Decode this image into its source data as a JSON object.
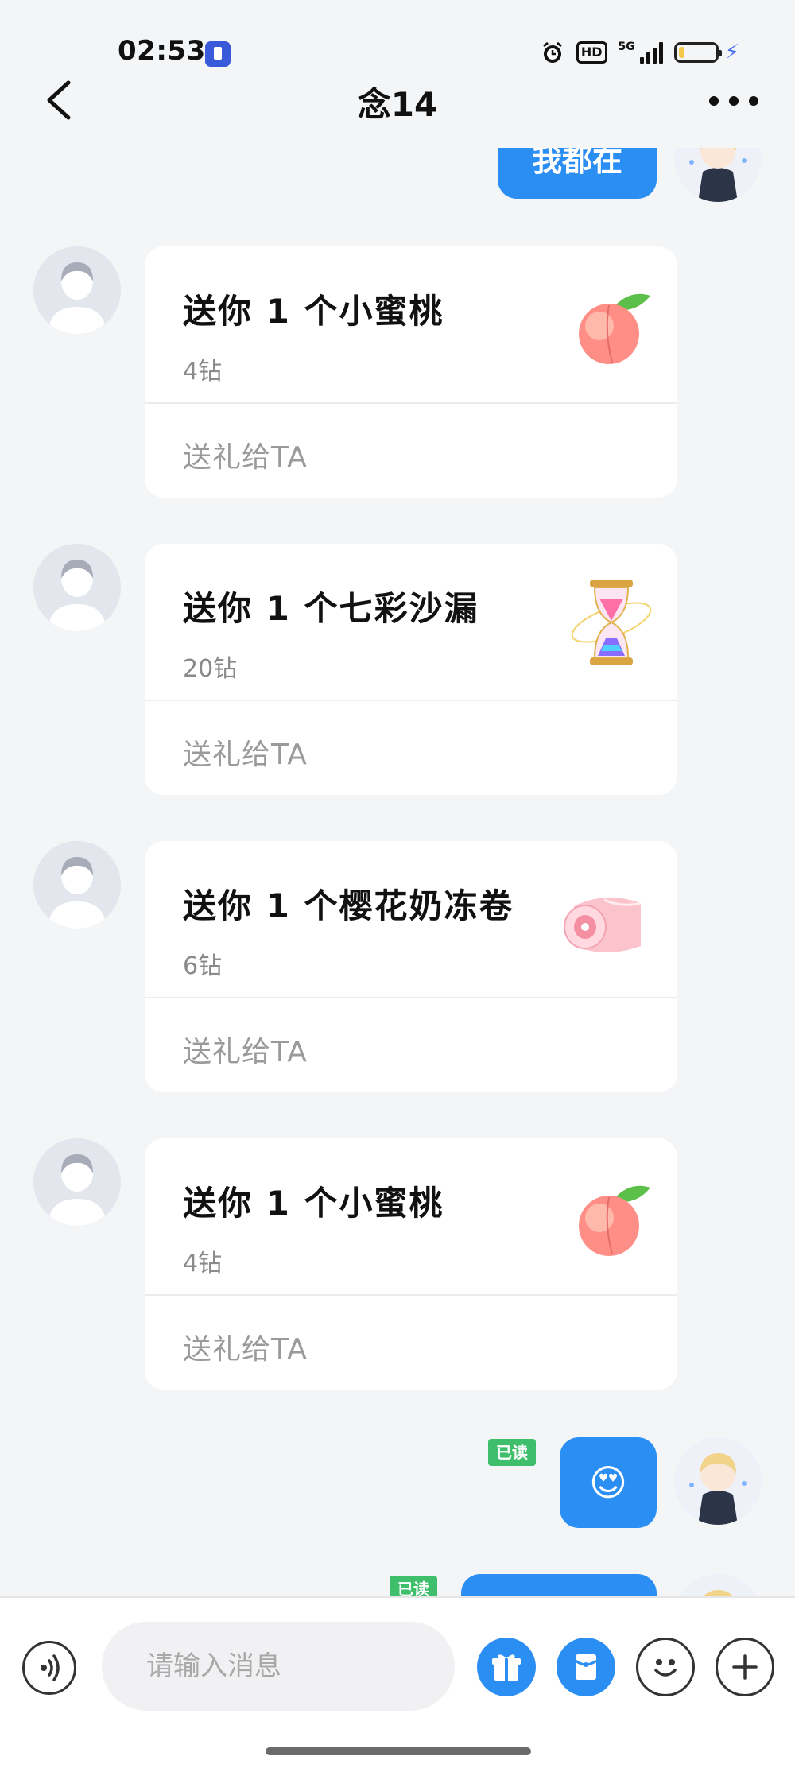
{
  "status_bar": {
    "time": "02:53",
    "hd": "HD",
    "network": "5G",
    "battery_level": 0.15
  },
  "header": {
    "title": "念14"
  },
  "messages": {
    "top_bubble_text": "我都在",
    "gifts": [
      {
        "title": "送你 1 个小蜜桃",
        "price": "4钻",
        "send_label": "送礼给TA",
        "icon": "peach-icon"
      },
      {
        "title": "送你 1 个七彩沙漏",
        "price": "20钻",
        "send_label": "送礼给TA",
        "icon": "hourglass-icon"
      },
      {
        "title": "送你 1 个樱花奶冻卷",
        "price": "6钻",
        "send_label": "送礼给TA",
        "icon": "sakura-roll-icon"
      },
      {
        "title": "送你 1 个小蜜桃",
        "price": "4钻",
        "send_label": "送礼给TA",
        "icon": "peach-icon"
      }
    ],
    "read_label": "已读",
    "emoji_message": "😍"
  },
  "input_bar": {
    "placeholder": "请输入消息"
  },
  "colors": {
    "bubble_blue": "#2b8ef3",
    "read_green": "#3fbf6c",
    "background": "#f4f5f7"
  }
}
